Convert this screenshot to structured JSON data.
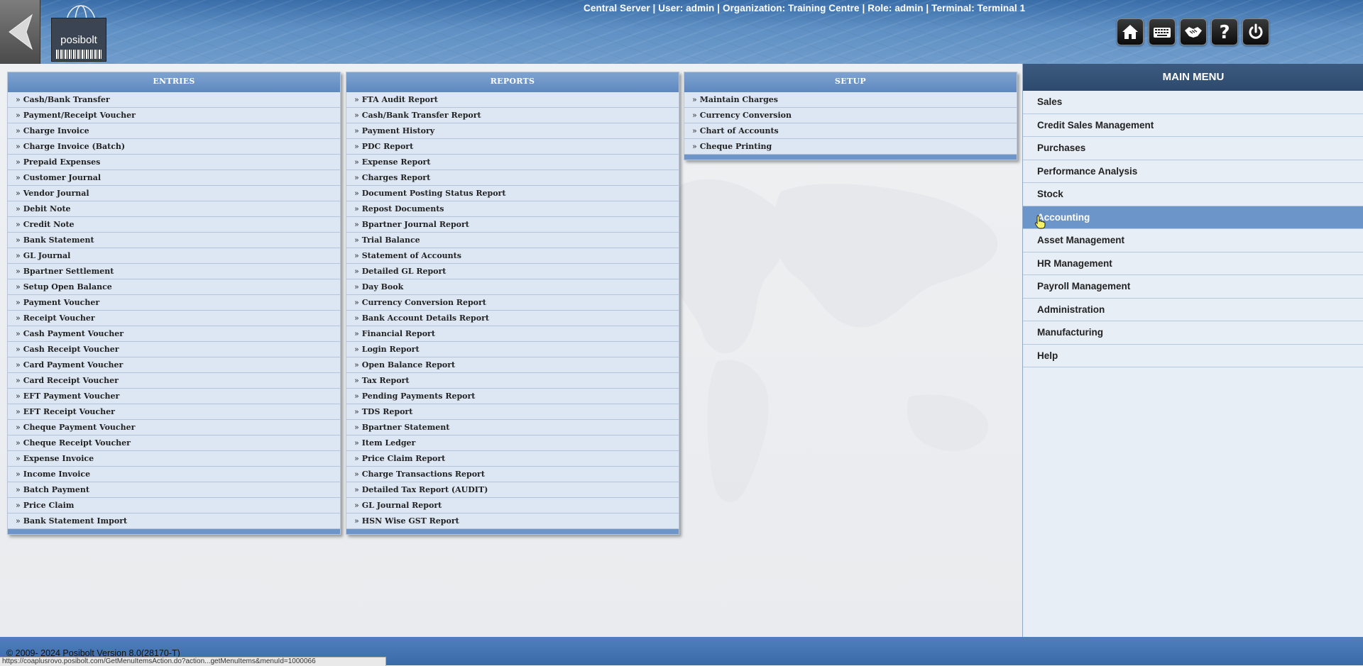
{
  "header": {
    "session_info": "Central Server | User: admin | Organization: Training Centre | Role: admin | Terminal: Terminal 1",
    "logo_text": "posibolt",
    "toolbar": [
      {
        "name": "home-button",
        "icon": "home-icon"
      },
      {
        "name": "keyboard-button",
        "icon": "keyboard-icon"
      },
      {
        "name": "handshake-button",
        "icon": "handshake-icon"
      },
      {
        "name": "help-button",
        "icon": "question-icon"
      },
      {
        "name": "logout-button",
        "icon": "power-icon"
      }
    ]
  },
  "panels": {
    "entries": {
      "title": "ENTRIES",
      "items": [
        "Cash/Bank Transfer",
        "Payment/Receipt Voucher",
        "Charge Invoice",
        "Charge Invoice (Batch)",
        "Prepaid Expenses",
        "Customer Journal",
        "Vendor Journal",
        "Debit Note",
        "Credit Note",
        "Bank Statement",
        "GL Journal",
        "Bpartner Settlement",
        "Setup Open Balance",
        "Payment Voucher",
        "Receipt Voucher",
        "Cash Payment Voucher",
        "Cash Receipt Voucher",
        "Card Payment Voucher",
        "Card Receipt Voucher",
        "EFT Payment Voucher",
        "EFT Receipt Voucher",
        "Cheque Payment Voucher",
        "Cheque Receipt Voucher",
        "Expense Invoice",
        "Income Invoice",
        "Batch Payment",
        "Price Claim",
        "Bank Statement Import"
      ]
    },
    "reports": {
      "title": "REPORTS",
      "items": [
        "FTA Audit Report",
        "Cash/Bank Transfer Report",
        "Payment History",
        "PDC Report",
        "Expense Report",
        "Charges Report",
        "Document Posting Status Report",
        "Repost Documents",
        "Bpartner Journal Report",
        "Trial Balance",
        "Statement of Accounts",
        "Detailed GL Report",
        "Day Book",
        "Currency Conversion Report",
        "Bank Account Details Report",
        "Financial Report",
        "Login Report",
        "Open Balance Report",
        "Tax Report",
        "Pending Payments Report",
        "TDS Report",
        "Bpartner Statement",
        "Item Ledger",
        "Price Claim Report",
        "Charge Transactions Report",
        "Detailed Tax Report (AUDIT)",
        "GL Journal Report",
        "HSN Wise GST Report"
      ]
    },
    "setup": {
      "title": "SETUP",
      "items": [
        "Maintain Charges",
        "Currency Conversion",
        "Chart of Accounts",
        "Cheque Printing"
      ]
    }
  },
  "main_menu": {
    "title": "MAIN MENU",
    "items": [
      "Sales",
      "Credit Sales Management",
      "Purchases",
      "Performance Analysis",
      "Stock",
      "Accounting",
      "Asset Management",
      "HR Management",
      "Payroll Management",
      "Administration",
      "Manufacturing",
      "Help"
    ],
    "active": "Accounting"
  },
  "footer": {
    "copyright": "© 2009- 2024 Posibolt Version 8.0(28170-T)",
    "status_url": "https://coaplusrovo.posibolt.com/GetMenuItemsAction.do?action...getMenuItems&menuId=1000066"
  },
  "colors": {
    "header_blue": "#5f90c4",
    "panel_header": "#6d95c8",
    "menu_header": "#2d4a6e",
    "active_item": "#6c96c9"
  }
}
